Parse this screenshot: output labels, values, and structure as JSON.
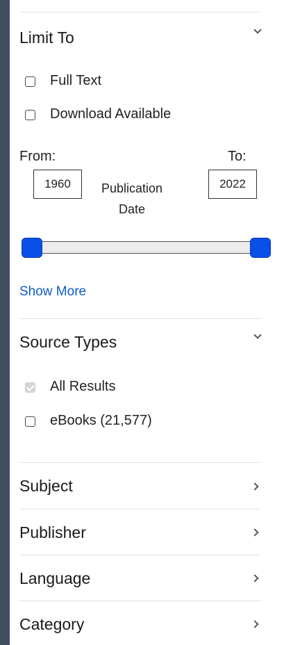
{
  "limit_to": {
    "title": "Limit To",
    "options": [
      {
        "label": "Full Text",
        "checked": false
      },
      {
        "label": "Download Available",
        "checked": false
      }
    ],
    "from_label": "From:",
    "to_label": "To:",
    "from_value": "1960",
    "to_value": "2022",
    "range_label_line1": "Publication",
    "range_label_line2": "Date",
    "show_more": "Show More"
  },
  "source_types": {
    "title": "Source Types",
    "options": [
      {
        "label": "All Results",
        "checked": true,
        "disabled": true
      },
      {
        "label": "eBooks (21,577)",
        "checked": false
      }
    ]
  },
  "facets": [
    {
      "title": "Subject"
    },
    {
      "title": "Publisher"
    },
    {
      "title": "Language"
    },
    {
      "title": "Category"
    }
  ],
  "colors": {
    "background": "#3f4f5f",
    "accent": "#0a4fe8",
    "link": "#0b5cc8"
  }
}
